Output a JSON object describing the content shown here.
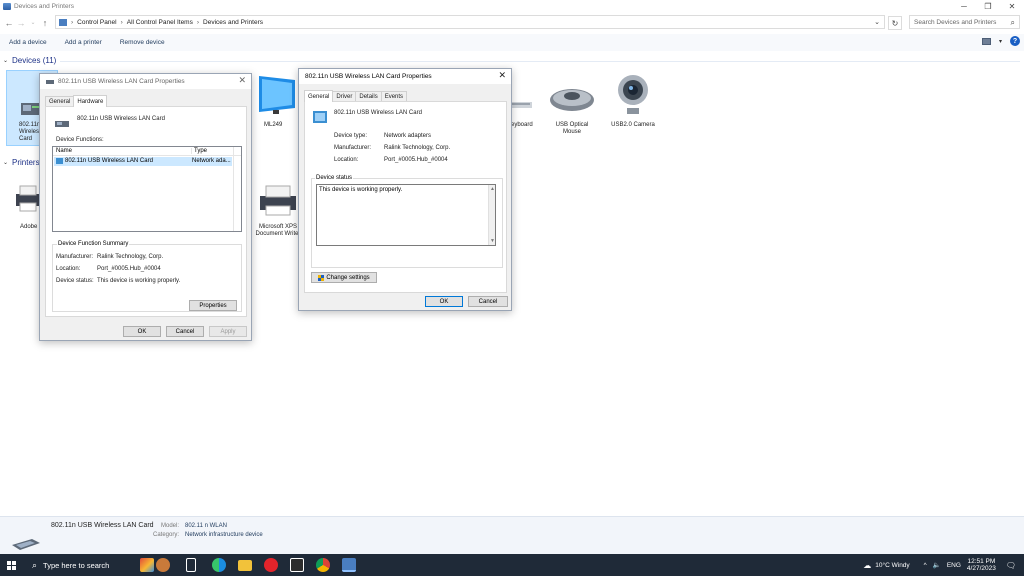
{
  "window": {
    "title": "Devices and Printers",
    "controls": [
      "─",
      "❐",
      "✕"
    ]
  },
  "address": {
    "crumbs": [
      "Control Panel",
      "All Control Panel Items",
      "Devices and Printers"
    ],
    "search_placeholder": "Search Devices and Printers"
  },
  "commands": {
    "add_device": "Add a device",
    "add_printer": "Add a printer",
    "remove_device": "Remove device"
  },
  "groups": {
    "devices": {
      "label": "Devices (11)"
    },
    "printers": {
      "label": "Printers"
    }
  },
  "devices": [
    {
      "label": "802.11n\nWireless\nCard"
    },
    {
      "label": "ML249"
    },
    {
      "label": "eyboard"
    },
    {
      "label": "USB Optical\nMouse"
    },
    {
      "label": "USB2.0 Camera"
    }
  ],
  "printers": [
    {
      "label": "Adobe"
    },
    {
      "label": "Microsoft XPS\nDocument Writer"
    }
  ],
  "dialog1": {
    "title": "802.11n USB Wireless LAN Card Properties",
    "tabs": [
      "General",
      "Hardware"
    ],
    "device_name": "802.11n USB Wireless LAN Card",
    "functions_label": "Device Functions:",
    "col_name": "Name",
    "col_type": "Type",
    "row_name": "802.11n USB Wireless LAN Card",
    "row_type": "Network ada...",
    "summary_title": "Device Function Summary",
    "manufacturer_label": "Manufacturer:",
    "manufacturer": "Ralink Technology, Corp.",
    "location_label": "Location:",
    "location": "Port_#0005.Hub_#0004",
    "status_label": "Device status:",
    "status": "This device is working properly.",
    "properties_btn": "Properties",
    "ok": "OK",
    "cancel": "Cancel",
    "apply": "Apply"
  },
  "dialog2": {
    "title": "802.11n USB Wireless LAN Card Properties",
    "tabs": [
      "General",
      "Driver",
      "Details",
      "Events"
    ],
    "device_name": "802.11n USB Wireless LAN Card",
    "type_label": "Device type:",
    "type": "Network adapters",
    "manufacturer_label": "Manufacturer:",
    "manufacturer": "Ralink Technology, Corp.",
    "location_label": "Location:",
    "location": "Port_#0005.Hub_#0004",
    "status_group": "Device status",
    "status": "This device is working properly.",
    "change_settings": "Change settings",
    "ok": "OK",
    "cancel": "Cancel"
  },
  "details": {
    "name": "802.11n USB Wireless LAN Card",
    "model_label": "Model:",
    "model": "802.11 n WLAN",
    "category_label": "Category:",
    "category": "Network infrastructure device"
  },
  "taskbar": {
    "search_placeholder": "Type here to search",
    "weather": "10°C  Windy",
    "lang": "ENG",
    "time": "12:51 PM",
    "date": "4/27/2023"
  }
}
